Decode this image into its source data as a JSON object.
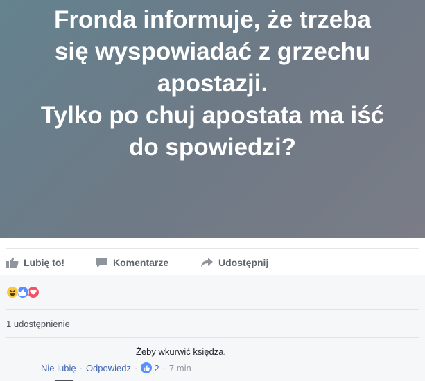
{
  "post": {
    "image_text": "Fronda informuje, że trzeba\nsię wyspowiadać z grzechu\napostazji.\nTylko po chuj apostata ma iść\ndo spowiedzi?"
  },
  "actions": {
    "like": "Lubię to!",
    "comment": "Komentarze",
    "share": "Udostępnij"
  },
  "reactions": [
    "haha-icon",
    "like-icon",
    "love-icon"
  ],
  "shares_text": "1 udostępnienie",
  "comment": {
    "text": "Żeby wkurwić księdza.",
    "unlike": "Nie lubię",
    "reply": "Odpowiedz",
    "likes": "2",
    "time": "7 min"
  },
  "colors": {
    "image_bg": "#6e7a86",
    "link": "#4267b2",
    "like_blue": "#5890ff",
    "love_red": "#f25268",
    "haha_yellow": "#f7c844"
  }
}
